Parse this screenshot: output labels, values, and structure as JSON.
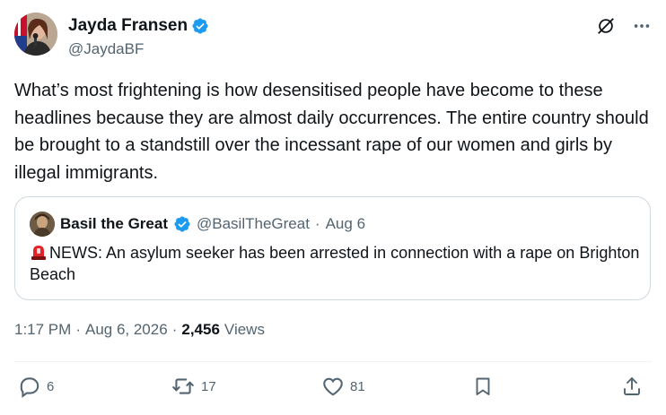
{
  "author": {
    "display_name": "Jayda Fransen",
    "handle": "@JaydaBF"
  },
  "tweet": {
    "text": "What’s most frightening is how desensitised people have become to these headlines because they are almost daily occurrences. The entire country should be brought to a standstill over the incessant rape of our women and girls by illegal immigrants."
  },
  "quote": {
    "display_name": "Basil the Great",
    "handle": "@BasilTheGreat",
    "separator": "·",
    "date": "Aug 6",
    "text": "NEWS: An asylum seeker has been arrested in connection with a rape on Brighton Beach"
  },
  "meta": {
    "time": "1:17 PM",
    "sep1": "·",
    "date": "Aug 6, 2026",
    "sep2": "·",
    "views_count": "2,456",
    "views_label": "Views"
  },
  "actions": {
    "replies": "6",
    "reposts": "17",
    "likes": "81"
  },
  "colors": {
    "verified": "#1d9bf0",
    "secondary_text": "#536471",
    "border": "#cfd9de"
  },
  "icons": [
    "verified-badge-icon",
    "grok-icon",
    "more-icon",
    "siren-icon",
    "reply-icon",
    "repost-icon",
    "like-icon",
    "bookmark-icon",
    "share-icon"
  ]
}
